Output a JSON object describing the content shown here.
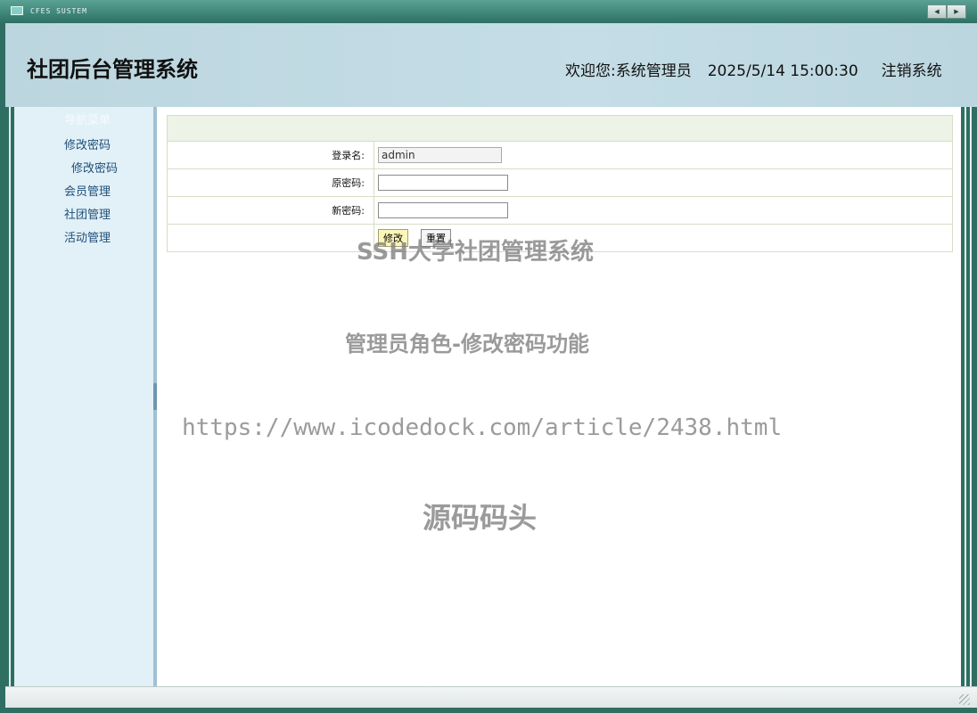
{
  "titlebar": {
    "app_title": "CFES SUSTEM",
    "prev_glyph": "◀",
    "next_glyph": "▶"
  },
  "header": {
    "system_title": "社团后台管理系统",
    "welcome_prefix": "欢迎您:",
    "user_name": "系统管理员",
    "datetime": "2025/5/14 15:00:30",
    "logout": "注销系统"
  },
  "sidebar": {
    "menu_title": "导航菜单",
    "items": [
      {
        "label": "修改密码",
        "type": "group"
      },
      {
        "label": "修改密码",
        "type": "sub"
      },
      {
        "label": "会员管理",
        "type": "group"
      },
      {
        "label": "社团管理",
        "type": "group"
      },
      {
        "label": "活动管理",
        "type": "group"
      }
    ]
  },
  "form": {
    "login_label": "登录名:",
    "login_value": "admin",
    "old_pwd_label": "原密码:",
    "old_pwd_value": "",
    "new_pwd_label": "新密码:",
    "new_pwd_value": "",
    "submit_label": "修改",
    "reset_label": "重置"
  },
  "watermark": {
    "line1": "SSH大学社团管理系统",
    "line2": "管理员角色-修改密码功能",
    "line3": "https://www.icodedock.com/article/2438.html",
    "line4": "源码码头"
  },
  "colors": {
    "frame": "#2f6f63",
    "header_bg": "#bcd6df",
    "sidebar_bg": "#e2f0f7",
    "menu_link": "#1d4f7a",
    "primary_button": "#fbf6b8"
  }
}
